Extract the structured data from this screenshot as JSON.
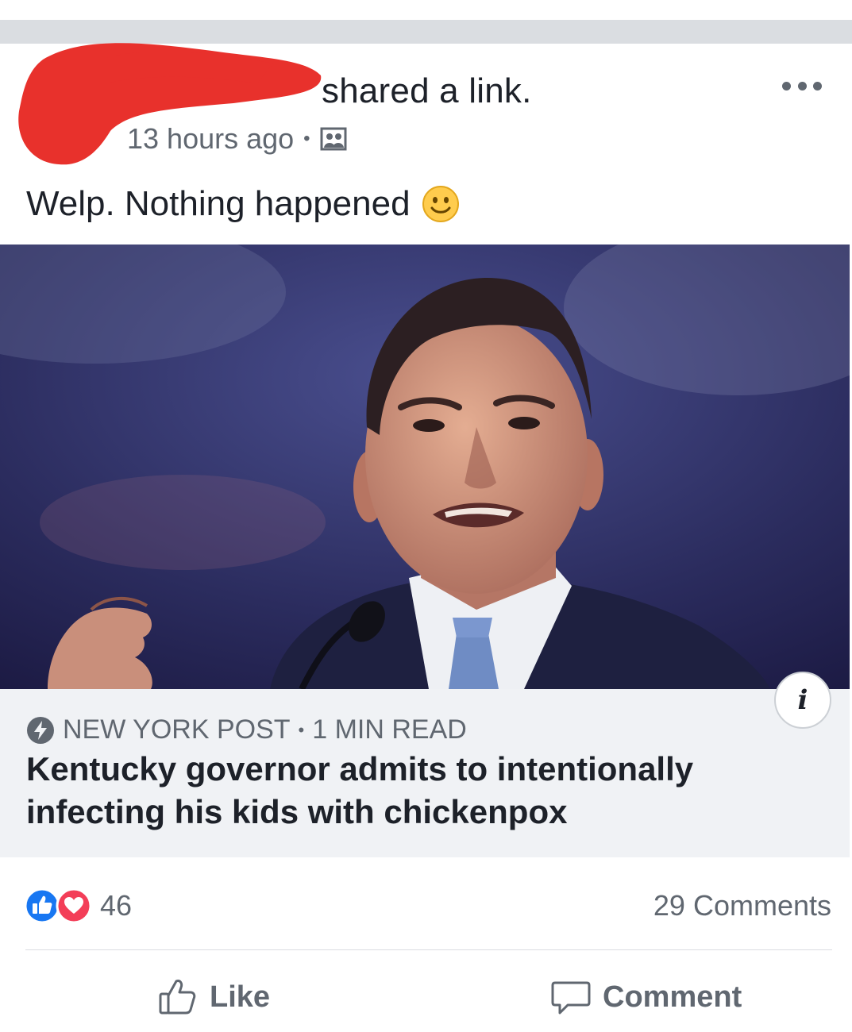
{
  "post": {
    "shared_text": "shared a link.",
    "timestamp": "13 hours ago",
    "separator": "•",
    "audience_icon": "friends-icon",
    "more_icon": "more-options-icon",
    "message": "Welp. Nothing happened",
    "message_emoji": "slightly-smiling-face-emoji"
  },
  "link": {
    "image_icon": "news-photo",
    "info_label": "i",
    "source": "NEW YORK POST",
    "separator": "•",
    "read_time": "1 MIN READ",
    "headline": "Kentucky governor admits to intentionally infecting his kids with chickenpox"
  },
  "engagement": {
    "reaction_icons": [
      "like-reaction-icon",
      "love-reaction-icon"
    ],
    "reaction_count": "46",
    "comments_count": "29 Comments"
  },
  "actions": {
    "like_label": "Like",
    "comment_label": "Comment"
  },
  "colors": {
    "redaction": "#e8312c",
    "like_blue": "#1877f2",
    "love_red": "#f33e58",
    "secondary_text": "#606770",
    "preview_bg": "#f0f2f5"
  }
}
